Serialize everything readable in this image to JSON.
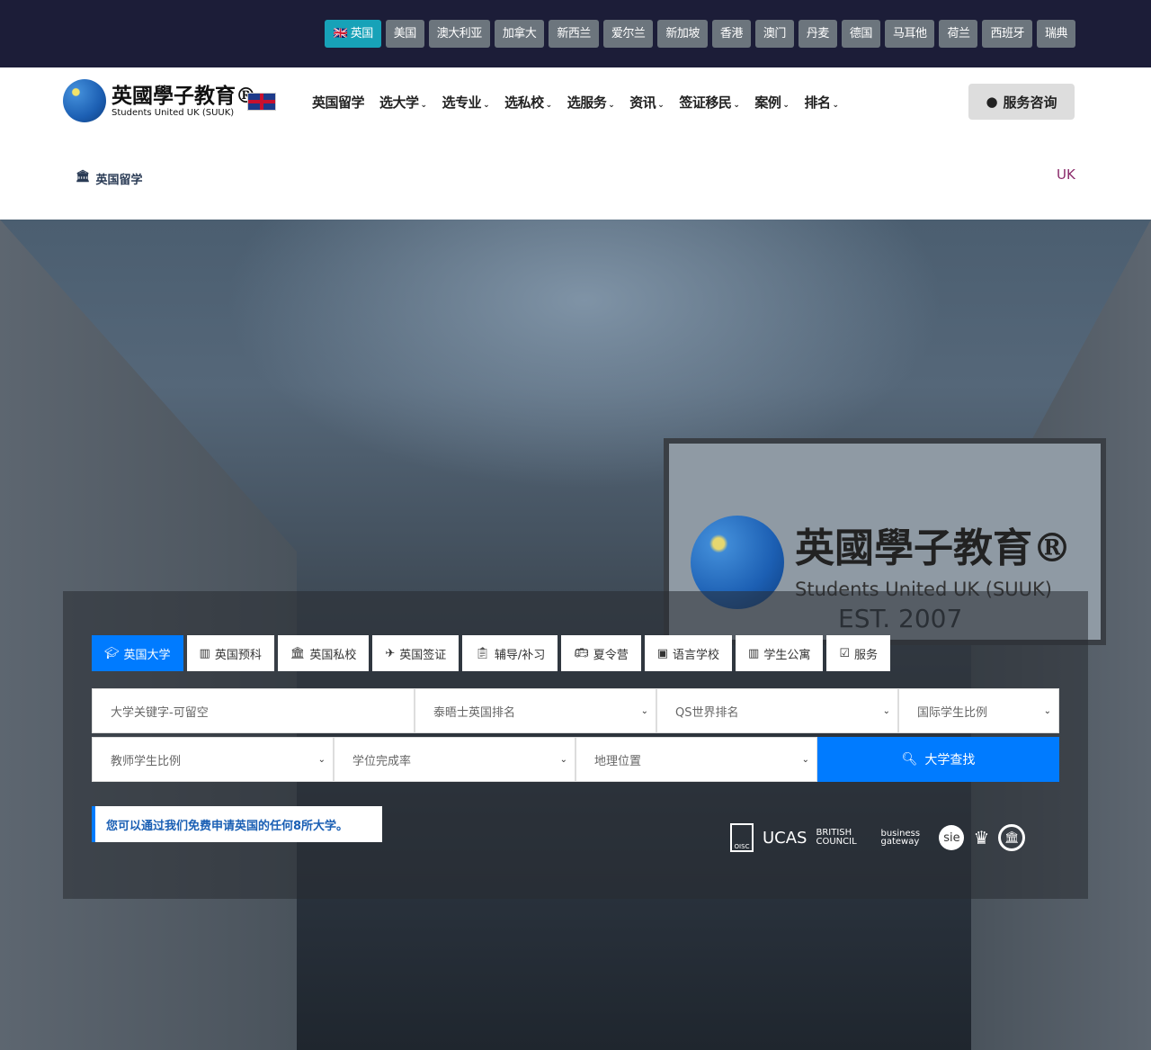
{
  "countries": [
    "英国",
    "美国",
    "澳大利亚",
    "加拿大",
    "新西兰",
    "爱尔兰",
    "新加坡",
    "香港",
    "澳门",
    "丹麦",
    "德国",
    "马耳他",
    "荷兰",
    "西班牙",
    "瑞典"
  ],
  "active_country": "英国",
  "logo": {
    "cn": "英國學子教育®",
    "en": "Students United UK (SUUK)"
  },
  "nav": [
    {
      "label": "英国留学",
      "dropdown": false
    },
    {
      "label": "选大学",
      "dropdown": true
    },
    {
      "label": "选专业",
      "dropdown": true
    },
    {
      "label": "选私校",
      "dropdown": true
    },
    {
      "label": "选服务",
      "dropdown": true
    },
    {
      "label": "资讯",
      "dropdown": true
    },
    {
      "label": "签证移民",
      "dropdown": true
    },
    {
      "label": "案例",
      "dropdown": true
    },
    {
      "label": "排名",
      "dropdown": true
    }
  ],
  "consult_label": "服务咨询",
  "breadcrumb": "英国留学",
  "region_label": "UK",
  "billboard": {
    "cn": "英國學子教育®",
    "en": "Students United UK (SUUK)",
    "est": "EST. 2007"
  },
  "tabs": [
    {
      "label": "英国大学",
      "icon": "graduation-cap-icon"
    },
    {
      "label": "英国预科",
      "icon": "building-icon"
    },
    {
      "label": "英国私校",
      "icon": "university-icon"
    },
    {
      "label": "英国签证",
      "icon": "plane-icon"
    },
    {
      "label": "辅导/补习",
      "icon": "clipboard-icon"
    },
    {
      "label": "夏令营",
      "icon": "bus-icon"
    },
    {
      "label": "语言学校",
      "icon": "book-icon"
    },
    {
      "label": "学生公寓",
      "icon": "building-icon"
    },
    {
      "label": "服务",
      "icon": "check-square-icon"
    }
  ],
  "search": {
    "keyword_placeholder": "大学关键字-可留空",
    "selects1": [
      "泰晤士英国排名",
      "QS世界排名",
      "国际学生比例"
    ],
    "selects2": [
      "教师学生比例",
      "学位完成率",
      "地理位置"
    ],
    "button": "大学查找"
  },
  "note": "您可以通过我们免费申请英国的任何8所大学。",
  "partners": [
    "OISC",
    "UCAS",
    "BRITISH COUNCIL",
    "business gateway",
    "sie"
  ],
  "colors": {
    "topbar": "#1c1d38",
    "active_country": "#17a2b8",
    "country": "#6c757d",
    "accent": "#007bff"
  }
}
